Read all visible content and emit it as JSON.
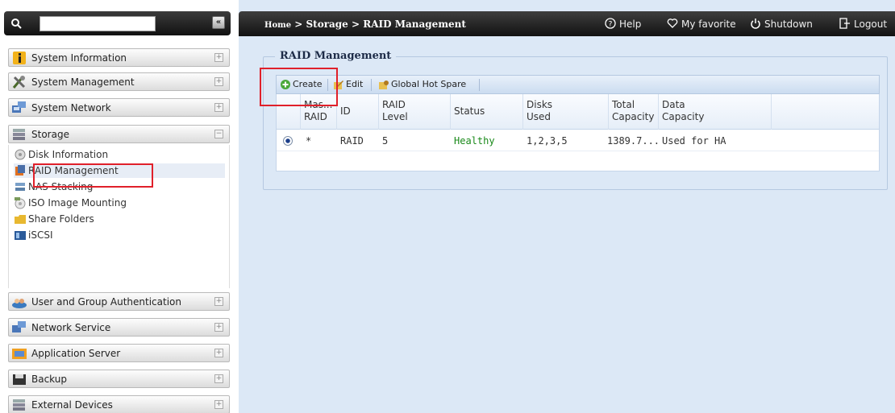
{
  "sidebar": {
    "search": {
      "placeholder": "",
      "value": ""
    },
    "collapse_label": "«",
    "categories": [
      {
        "label": "System Information",
        "icon": "info-icon",
        "toggle": "+"
      },
      {
        "label": "System Management",
        "icon": "tools-icon",
        "toggle": "+"
      },
      {
        "label": "System Network",
        "icon": "network-icon",
        "toggle": "+"
      },
      {
        "label": "Storage",
        "icon": "storage-icon",
        "toggle": "−"
      },
      {
        "label": "User and Group Authentication",
        "icon": "users-icon",
        "toggle": "+"
      },
      {
        "label": "Network Service",
        "icon": "network-service-icon",
        "toggle": "+"
      },
      {
        "label": "Application Server",
        "icon": "app-server-icon",
        "toggle": "+"
      },
      {
        "label": "Backup",
        "icon": "backup-icon",
        "toggle": "+"
      },
      {
        "label": "External Devices",
        "icon": "external-devices-icon",
        "toggle": "+"
      }
    ],
    "storage_items": [
      {
        "label": "Disk Information",
        "icon": "disk-icon"
      },
      {
        "label": "RAID Management",
        "icon": "raid-icon",
        "selected": true
      },
      {
        "label": "NAS Stacking",
        "icon": "nas-stacking-icon"
      },
      {
        "label": "ISO Image Mounting",
        "icon": "iso-icon"
      },
      {
        "label": "Share Folders",
        "icon": "folder-icon"
      },
      {
        "label": "iSCSI",
        "icon": "iscsi-icon"
      }
    ]
  },
  "header": {
    "breadcrumb": {
      "home": "Home",
      "sep": " > ",
      "parts": [
        "Storage",
        "RAID Management"
      ]
    },
    "help_label": "Help",
    "favorite_label": "My favorite",
    "shutdown_label": "Shutdown",
    "logout_label": "Logout"
  },
  "main": {
    "panel_title": "RAID Management",
    "toolbar": {
      "create_label": "Create",
      "edit_label": "Edit",
      "hotspare_label": "Global Hot Spare"
    },
    "table": {
      "columns": [
        [
          "Mas...",
          "RAID"
        ],
        [
          "ID"
        ],
        [
          "RAID",
          "Level"
        ],
        [
          "Status"
        ],
        [
          "Disks",
          "Used"
        ],
        [
          "Total",
          "Capacity"
        ],
        [
          "Data",
          "Capacity"
        ]
      ],
      "rows": [
        {
          "master": "*",
          "id": "RAID",
          "level": "5",
          "status": "Healthy",
          "disks": "1,2,3,5",
          "total": "1389.7...",
          "data": "Used for HA"
        }
      ]
    }
  },
  "colors": {
    "accent_blue": "#dce8f6",
    "healthy_green": "#1a8a1a",
    "highlight_red": "#e0202a",
    "topbar_black": "#1a1a1a"
  }
}
